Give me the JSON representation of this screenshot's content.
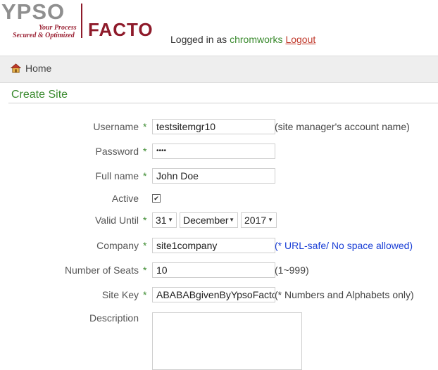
{
  "header": {
    "logo_top": "YPSO",
    "tagline_1": "Your Process",
    "tagline_2": "Secured & Optimized",
    "logo_bottom": "FACTO",
    "logged_in_as": "Logged in as ",
    "username": "chromworks",
    "logout": "Logout"
  },
  "nav": {
    "home": "Home"
  },
  "page": {
    "title": "Create Site"
  },
  "form": {
    "required_mark": "*",
    "username": {
      "label": "Username",
      "value": "testsitemgr10",
      "hint": "(site manager's account name)"
    },
    "password": {
      "label": "Password",
      "value": "••••"
    },
    "fullname": {
      "label": "Full name",
      "value": "John Doe"
    },
    "active": {
      "label": "Active",
      "checked": true,
      "mark": "✔"
    },
    "valid_until": {
      "label": "Valid Until",
      "day": "31",
      "month": "December",
      "year": "2017"
    },
    "company": {
      "label": "Company",
      "value": "site1company",
      "hint": "(* URL-safe/ No space allowed)"
    },
    "seats": {
      "label": "Number of Seats",
      "value": "10",
      "hint": "(1~999)"
    },
    "sitekey": {
      "label": "Site Key",
      "value": "ABABABgivenByYpsoFacto",
      "hint": "(* Numbers and Alphabets only)"
    },
    "description": {
      "label": "Description",
      "value": ""
    }
  },
  "colors": {
    "brand": "#8e1a2a",
    "accent_green": "#3a8a2e",
    "hint_blue": "#1a3fd6"
  }
}
